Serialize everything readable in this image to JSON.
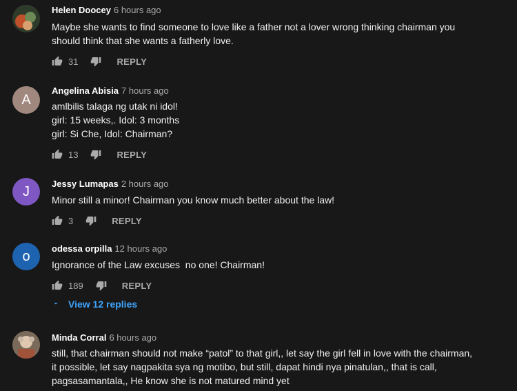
{
  "comments": [
    {
      "author": "Helen Doocey",
      "time": "6 hours ago",
      "lines": [
        "Maybe she wants to find someone to love like a father not a lover wrong thinking chairman you",
        "should think that she wants a fatherly love."
      ],
      "likes": "31",
      "reply_label": "REPLY",
      "avatar_letter": "",
      "avatar_color": "#6b4a3a"
    },
    {
      "author": "Angelina Abisia",
      "time": "7 hours ago",
      "lines": [
        "amlbilis talaga ng utak ni idol!",
        "girl: 15 weeks,. Idol: 3 months",
        "girl: Si Che, Idol: Chairman?"
      ],
      "likes": "13",
      "reply_label": "REPLY",
      "avatar_letter": "A",
      "avatar_color": "#a1887f"
    },
    {
      "author": "Jessy Lumapas",
      "time": "2 hours ago",
      "lines": [
        "Minor still a minor! Chairman you know much better about the law!"
      ],
      "likes": "3",
      "reply_label": "REPLY",
      "avatar_letter": "J",
      "avatar_color": "#7e57c2"
    },
    {
      "author": "odessa orpilla",
      "time": "12 hours ago",
      "lines": [
        "Ignorance of the Law excuses  no one! Chairman!"
      ],
      "likes": "189",
      "reply_label": "REPLY",
      "avatar_letter": "o",
      "avatar_color": "#1e63b0",
      "view_replies": "View 12 replies"
    },
    {
      "author": "Minda Corral",
      "time": "6 hours ago",
      "lines": [
        "still, that chairman should not make “patol” to that girl,, let say the girl fell in love with the chairman,",
        "it possible, let say nagpakita sya ng motibo, but still, dapat hindi nya pinatulan,, that is call,",
        "pagsasamantala,, He know she is not matured mind yet"
      ],
      "avatar_letter": "",
      "avatar_color": "#8a7a6a"
    }
  ],
  "icons": {
    "like": "thumbs-up-icon",
    "dislike": "thumbs-down-icon",
    "expand": "chevron-down-icon"
  },
  "colors": {
    "background": "#181818",
    "link": "#3ea6ff",
    "muted": "#aaaaaa"
  }
}
